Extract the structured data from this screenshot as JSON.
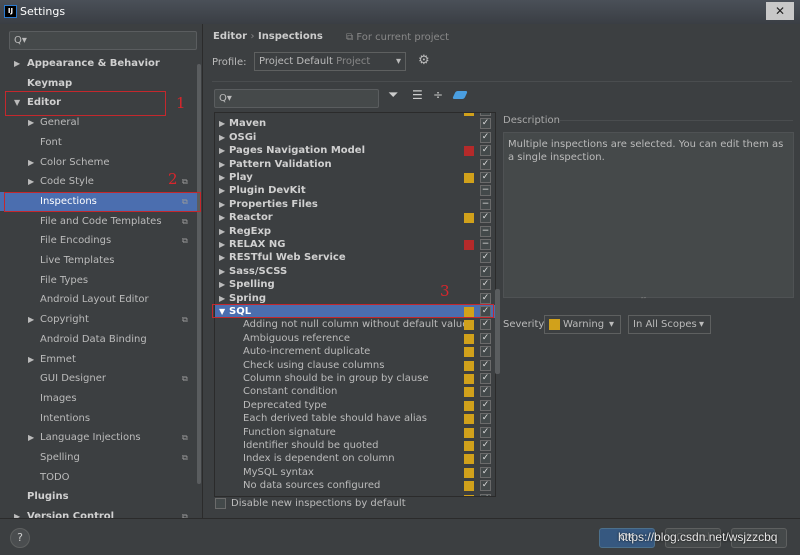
{
  "window": {
    "title": "Settings",
    "logo": "IJ",
    "close": "✕"
  },
  "sidebar": {
    "search_placeholder": "Q▾",
    "items": [
      {
        "label": "Appearance & Behavior",
        "level": 0,
        "arrow": "▶",
        "bold": true
      },
      {
        "label": "Keymap",
        "level": 0,
        "arrow": "",
        "bold": true
      },
      {
        "label": "Editor",
        "level": 0,
        "arrow": "▼",
        "bold": true
      },
      {
        "label": "General",
        "level": 1,
        "arrow": "▶"
      },
      {
        "label": "Font",
        "level": 1,
        "arrow": ""
      },
      {
        "label": "Color Scheme",
        "level": 1,
        "arrow": "▶"
      },
      {
        "label": "Code Style",
        "level": 1,
        "arrow": "▶",
        "copy": true
      },
      {
        "label": "Inspections",
        "level": 1,
        "arrow": "",
        "copy": true,
        "selected": true
      },
      {
        "label": "File and Code Templates",
        "level": 1,
        "arrow": "",
        "copy": true
      },
      {
        "label": "File Encodings",
        "level": 1,
        "arrow": "",
        "copy": true
      },
      {
        "label": "Live Templates",
        "level": 1,
        "arrow": ""
      },
      {
        "label": "File Types",
        "level": 1,
        "arrow": ""
      },
      {
        "label": "Android Layout Editor",
        "level": 1,
        "arrow": ""
      },
      {
        "label": "Copyright",
        "level": 1,
        "arrow": "▶",
        "copy": true
      },
      {
        "label": "Android Data Binding",
        "level": 1,
        "arrow": ""
      },
      {
        "label": "Emmet",
        "level": 1,
        "arrow": "▶"
      },
      {
        "label": "GUI Designer",
        "level": 1,
        "arrow": "",
        "copy": true
      },
      {
        "label": "Images",
        "level": 1,
        "arrow": ""
      },
      {
        "label": "Intentions",
        "level": 1,
        "arrow": ""
      },
      {
        "label": "Language Injections",
        "level": 1,
        "arrow": "▶",
        "copy": true
      },
      {
        "label": "Spelling",
        "level": 1,
        "arrow": "",
        "copy": true
      },
      {
        "label": "TODO",
        "level": 1,
        "arrow": ""
      },
      {
        "label": "Plugins",
        "level": 0,
        "arrow": "",
        "bold": true
      },
      {
        "label": "Version Control",
        "level": 0,
        "arrow": "▶",
        "bold": true,
        "copy": true
      }
    ]
  },
  "annotations": [
    "1",
    "2",
    "3"
  ],
  "breadcrumb": {
    "parent": "Editor",
    "sep": "›",
    "current": "Inspections",
    "scope": "⧉ For current project"
  },
  "profile": {
    "label": "Profile:",
    "value": "Project Default",
    "scope": "Project",
    "arrow": "▾",
    "gear": "⚙"
  },
  "tree_search_placeholder": "Q▾",
  "toolbar_icons": [
    "filter-icon",
    "expand-all-icon",
    "collapse-all-icon",
    "eraser-icon"
  ],
  "colors": {
    "warning": "#d1a11b",
    "error": "#b52a2a",
    "selection": "#4b6eaf"
  },
  "tree": [
    {
      "label": "",
      "arrow": "",
      "sev": "warning",
      "check": "✓",
      "bold": true
    },
    {
      "label": "Maven",
      "arrow": "▶",
      "check": "✓",
      "bold": true
    },
    {
      "label": "OSGi",
      "arrow": "▶",
      "check": "✓",
      "bold": true
    },
    {
      "label": "Pages Navigation Model",
      "arrow": "▶",
      "sev": "error",
      "check": "✓",
      "bold": true
    },
    {
      "label": "Pattern Validation",
      "arrow": "▶",
      "check": "✓",
      "bold": true
    },
    {
      "label": "Play",
      "arrow": "▶",
      "sev": "warning",
      "check": "✓",
      "bold": true
    },
    {
      "label": "Plugin DevKit",
      "arrow": "▶",
      "check": "−",
      "bold": true
    },
    {
      "label": "Properties Files",
      "arrow": "▶",
      "check": "−",
      "bold": true
    },
    {
      "label": "Reactor",
      "arrow": "▶",
      "sev": "warning",
      "check": "✓",
      "bold": true
    },
    {
      "label": "RegExp",
      "arrow": "▶",
      "check": "−",
      "bold": true
    },
    {
      "label": "RELAX NG",
      "arrow": "▶",
      "sev": "error",
      "check": "−",
      "bold": true
    },
    {
      "label": "RESTful Web Service",
      "arrow": "▶",
      "check": "✓",
      "bold": true
    },
    {
      "label": "Sass/SCSS",
      "arrow": "▶",
      "check": "✓",
      "bold": true
    },
    {
      "label": "Spelling",
      "arrow": "▶",
      "check": "✓",
      "bold": true
    },
    {
      "label": "Spring",
      "arrow": "▶",
      "check": "✓",
      "bold": true
    },
    {
      "label": "SQL",
      "arrow": "▼",
      "sev": "warning",
      "check": "✓",
      "bold": true,
      "selected": true
    },
    {
      "label": "Adding not null column without default value",
      "sev": "warning",
      "check": "✓",
      "child": true
    },
    {
      "label": "Ambiguous reference",
      "sev": "warning",
      "check": "✓",
      "child": true
    },
    {
      "label": "Auto-increment duplicate",
      "sev": "warning",
      "check": "✓",
      "child": true
    },
    {
      "label": "Check using clause columns",
      "sev": "warning",
      "check": "✓",
      "child": true
    },
    {
      "label": "Column should be in group by clause",
      "sev": "warning",
      "check": "✓",
      "child": true
    },
    {
      "label": "Constant condition",
      "sev": "warning",
      "check": "✓",
      "child": true
    },
    {
      "label": "Deprecated type",
      "sev": "warning",
      "check": "✓",
      "child": true
    },
    {
      "label": "Each derived table should have alias",
      "sev": "warning",
      "check": "✓",
      "child": true
    },
    {
      "label": "Function signature",
      "sev": "warning",
      "check": "✓",
      "child": true
    },
    {
      "label": "Identifier should be quoted",
      "sev": "warning",
      "check": "✓",
      "child": true
    },
    {
      "label": "Index is dependent on column",
      "sev": "warning",
      "check": "✓",
      "child": true
    },
    {
      "label": "MySQL syntax",
      "sev": "warning",
      "check": "✓",
      "child": true
    },
    {
      "label": "No data sources configured",
      "sev": "warning",
      "check": "✓",
      "child": true
    },
    {
      "label": "",
      "sev": "warning",
      "check": "✓",
      "child": true
    }
  ],
  "disable_new": {
    "label": "Disable new inspections by default",
    "checked": false
  },
  "description": {
    "title": "Description",
    "text": "Multiple inspections are selected. You can edit them as a single inspection."
  },
  "severity": {
    "label": "Severity:",
    "value": "Warning",
    "arrow": "▾",
    "scope": "In All Scopes"
  },
  "buttons": {
    "help": "?",
    "ok": "OK",
    "cancel": "Cancel",
    "apply": "Apply"
  },
  "watermark": "https://blog.csdn.net/wsjzzcbq"
}
